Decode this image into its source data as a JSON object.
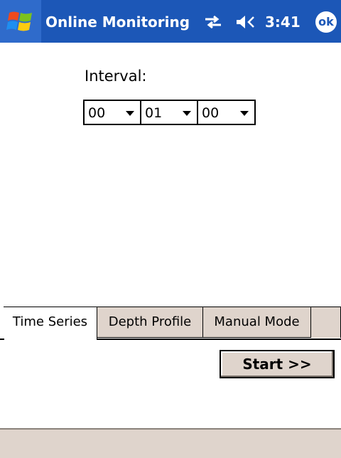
{
  "title_bar": {
    "app_title": "Online Monitoring",
    "clock": "3:41",
    "ok_label": "ok",
    "start_icon": "windows-flag-icon",
    "connectivity_icon": "connectivity-icon",
    "volume_icon": "speaker-off-icon"
  },
  "interval": {
    "label": "Interval:",
    "hours": "00",
    "minutes": "01",
    "seconds": "00"
  },
  "tabs": [
    {
      "label": "Time Series",
      "active": true
    },
    {
      "label": "Depth Profile",
      "active": false
    },
    {
      "label": "Manual Mode",
      "active": false
    }
  ],
  "actions": {
    "start_label": "Start >>"
  },
  "colors": {
    "title_bar": "#1c57b7",
    "panel": "#dfd4cc"
  }
}
